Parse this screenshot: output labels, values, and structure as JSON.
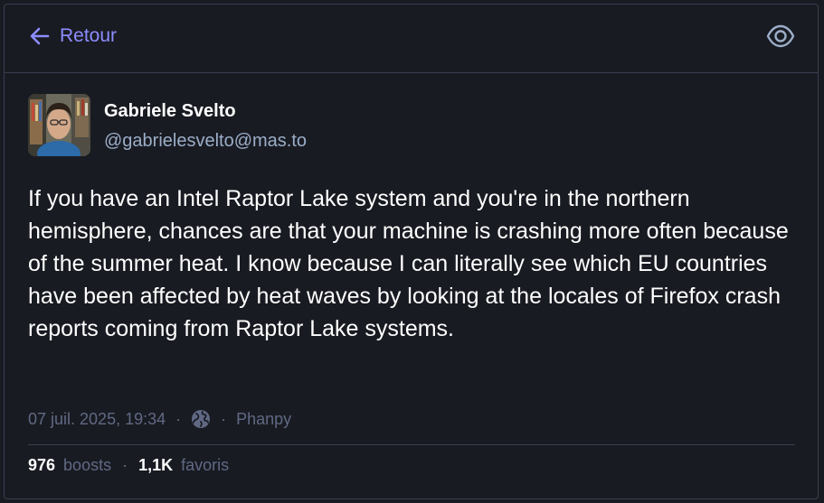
{
  "header": {
    "back_label": "Retour",
    "back_icon": "arrow-left-icon",
    "visibility_icon": "eye-icon",
    "accent_color": "#8c8dff"
  },
  "author": {
    "display_name": "Gabriele Svelto",
    "handle": "@gabrielesvelto@mas.to"
  },
  "post": {
    "text": "If you have an Intel Raptor Lake system and you're in the northern hemisphere, chances are that your machine is crashing more often because of the summer heat. I know because I can literally see which EU countries have been affected by heat waves by looking at the locales of Firefox crash reports coming from Raptor Lake systems."
  },
  "meta": {
    "timestamp": "07 juil. 2025, 19:34",
    "separator": "·",
    "visibility_icon": "globe-icon",
    "application": "Phanpy"
  },
  "stats": {
    "boosts_count": "976",
    "boosts_label": "boosts",
    "separator": "·",
    "favourites_count": "1,1K",
    "favourites_label": "favoris"
  }
}
